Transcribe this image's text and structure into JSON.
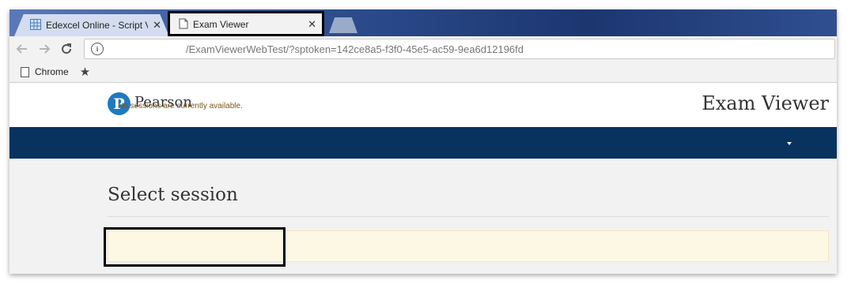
{
  "browser": {
    "tabs": [
      {
        "title": "Edexcel Online - Script V",
        "active": false,
        "icon": "grid-icon"
      },
      {
        "title": "Exam Viewer",
        "active": true,
        "icon": "page-icon"
      }
    ],
    "tab_close_glyph": "✕",
    "url": "/ExamViewerWebTest/?sptoken=142ce8a5-f3f0-45e5-ac59-9ea6d12196fd",
    "bookmarks": [
      {
        "label": "Chrome"
      }
    ]
  },
  "header": {
    "logo_letter": "P",
    "logo_text": "Pearson",
    "app_title": "Exam Viewer"
  },
  "main": {
    "heading": "Select session",
    "alert_message": "No sessions are currently available."
  },
  "colors": {
    "navbar": "#07335e",
    "brand_blue": "#1f7abf",
    "alert_bg": "#fcf8e3",
    "highlight_border": "#000000"
  }
}
